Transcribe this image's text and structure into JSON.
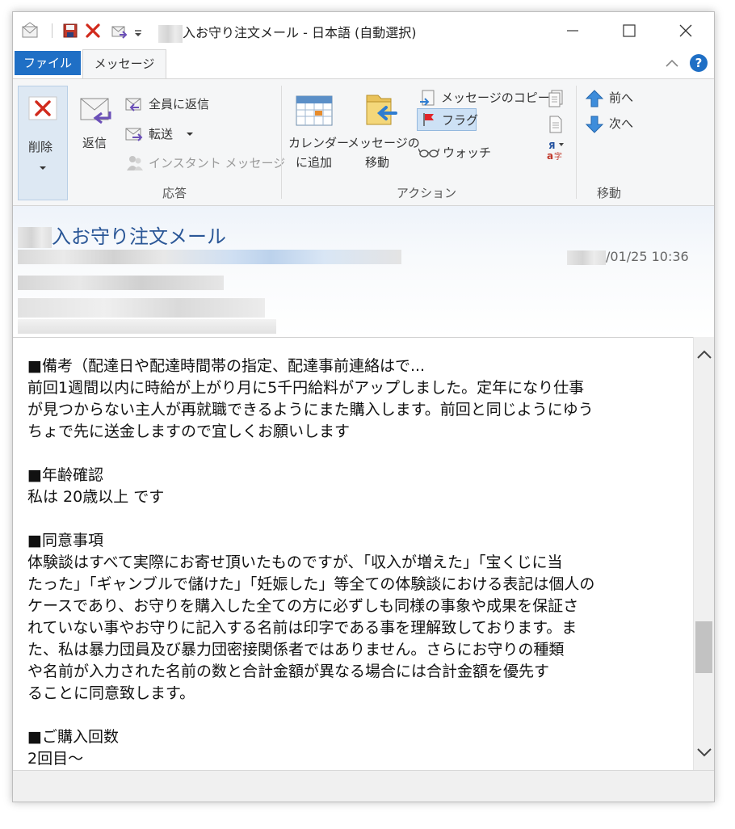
{
  "window": {
    "title_suffix": "入お守り注文メール - 日本語 (自動選択)",
    "minimize_icon": "minimize-icon",
    "maximize_icon": "maximize-icon",
    "close_icon": "close-icon"
  },
  "ribbon": {
    "tabs": {
      "file": "ファイル",
      "message": "メッセージ"
    },
    "delete": {
      "label": "削除"
    },
    "respond": {
      "reply": "返信",
      "reply_all": "全員に返信",
      "forward": "転送",
      "instant_message": "インスタント メッセージ",
      "group_label": "応答"
    },
    "actions": {
      "calendar_line1": "カレンダー",
      "calendar_line2": "に追加",
      "move_line1": "メッセージの",
      "move_line2": "移動",
      "copy": "メッセージのコピー",
      "flag": "フラグ",
      "watch": "ウォッチ",
      "group_label": "アクション"
    },
    "navigate": {
      "prev": "前へ",
      "next": "次へ",
      "group_label": "移動"
    }
  },
  "header": {
    "subject_suffix": "入お守り注文メール",
    "datetime_suffix": "/01/25 10:36"
  },
  "body": {
    "section1_title": "■備考（配達日や配達時間帯の指定、配達事前連絡はで...",
    "section1_lines": [
      "前回1週間以内に時給が上がり月に5千円給料がアップしました。定年になり仕事",
      "が見つからない主人が再就職できるようにまた購入します。前回と同じようにゆう",
      "ちょで先に送金しますので宜しくお願いします"
    ],
    "section2_title": "■年齢確認",
    "section2_text": "私は 20歳以上 です",
    "section3_title": "■同意事項",
    "section3_lines": [
      "体験談はすべて実際にお寄せ頂いたものですが、「収入が増えた」「宝くじに当",
      "たった」「ギャンブルで儲けた」「妊娠した」等全ての体験談における表記は個人の",
      "ケースであり、お守りを購入した全ての方に必ずしも同様の事象や成果を保証さ",
      "れていない事やお守りに記入する名前は印字である事を理解致しております。ま",
      "た、私は暴力団員及び暴力団密接関係者ではありません。さらにお守りの種類",
      "や名前が入力された名前の数と合計金額が異なる場合には合計金額を優先す",
      "ることに同意致します。"
    ],
    "section4_title": "■ご購入回数",
    "section4_text": "2回目～"
  }
}
